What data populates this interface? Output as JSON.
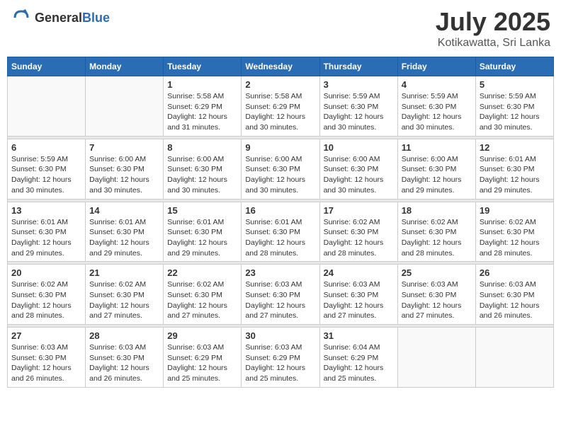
{
  "header": {
    "logo_general": "General",
    "logo_blue": "Blue",
    "month": "July 2025",
    "location": "Kotikawatta, Sri Lanka"
  },
  "days_of_week": [
    "Sunday",
    "Monday",
    "Tuesday",
    "Wednesday",
    "Thursday",
    "Friday",
    "Saturday"
  ],
  "weeks": [
    [
      {
        "day": "",
        "info": ""
      },
      {
        "day": "",
        "info": ""
      },
      {
        "day": "1",
        "info": "Sunrise: 5:58 AM\nSunset: 6:29 PM\nDaylight: 12 hours and 31 minutes."
      },
      {
        "day": "2",
        "info": "Sunrise: 5:58 AM\nSunset: 6:29 PM\nDaylight: 12 hours and 30 minutes."
      },
      {
        "day": "3",
        "info": "Sunrise: 5:59 AM\nSunset: 6:30 PM\nDaylight: 12 hours and 30 minutes."
      },
      {
        "day": "4",
        "info": "Sunrise: 5:59 AM\nSunset: 6:30 PM\nDaylight: 12 hours and 30 minutes."
      },
      {
        "day": "5",
        "info": "Sunrise: 5:59 AM\nSunset: 6:30 PM\nDaylight: 12 hours and 30 minutes."
      }
    ],
    [
      {
        "day": "6",
        "info": "Sunrise: 5:59 AM\nSunset: 6:30 PM\nDaylight: 12 hours and 30 minutes."
      },
      {
        "day": "7",
        "info": "Sunrise: 6:00 AM\nSunset: 6:30 PM\nDaylight: 12 hours and 30 minutes."
      },
      {
        "day": "8",
        "info": "Sunrise: 6:00 AM\nSunset: 6:30 PM\nDaylight: 12 hours and 30 minutes."
      },
      {
        "day": "9",
        "info": "Sunrise: 6:00 AM\nSunset: 6:30 PM\nDaylight: 12 hours and 30 minutes."
      },
      {
        "day": "10",
        "info": "Sunrise: 6:00 AM\nSunset: 6:30 PM\nDaylight: 12 hours and 30 minutes."
      },
      {
        "day": "11",
        "info": "Sunrise: 6:00 AM\nSunset: 6:30 PM\nDaylight: 12 hours and 29 minutes."
      },
      {
        "day": "12",
        "info": "Sunrise: 6:01 AM\nSunset: 6:30 PM\nDaylight: 12 hours and 29 minutes."
      }
    ],
    [
      {
        "day": "13",
        "info": "Sunrise: 6:01 AM\nSunset: 6:30 PM\nDaylight: 12 hours and 29 minutes."
      },
      {
        "day": "14",
        "info": "Sunrise: 6:01 AM\nSunset: 6:30 PM\nDaylight: 12 hours and 29 minutes."
      },
      {
        "day": "15",
        "info": "Sunrise: 6:01 AM\nSunset: 6:30 PM\nDaylight: 12 hours and 29 minutes."
      },
      {
        "day": "16",
        "info": "Sunrise: 6:01 AM\nSunset: 6:30 PM\nDaylight: 12 hours and 28 minutes."
      },
      {
        "day": "17",
        "info": "Sunrise: 6:02 AM\nSunset: 6:30 PM\nDaylight: 12 hours and 28 minutes."
      },
      {
        "day": "18",
        "info": "Sunrise: 6:02 AM\nSunset: 6:30 PM\nDaylight: 12 hours and 28 minutes."
      },
      {
        "day": "19",
        "info": "Sunrise: 6:02 AM\nSunset: 6:30 PM\nDaylight: 12 hours and 28 minutes."
      }
    ],
    [
      {
        "day": "20",
        "info": "Sunrise: 6:02 AM\nSunset: 6:30 PM\nDaylight: 12 hours and 28 minutes."
      },
      {
        "day": "21",
        "info": "Sunrise: 6:02 AM\nSunset: 6:30 PM\nDaylight: 12 hours and 27 minutes."
      },
      {
        "day": "22",
        "info": "Sunrise: 6:02 AM\nSunset: 6:30 PM\nDaylight: 12 hours and 27 minutes."
      },
      {
        "day": "23",
        "info": "Sunrise: 6:03 AM\nSunset: 6:30 PM\nDaylight: 12 hours and 27 minutes."
      },
      {
        "day": "24",
        "info": "Sunrise: 6:03 AM\nSunset: 6:30 PM\nDaylight: 12 hours and 27 minutes."
      },
      {
        "day": "25",
        "info": "Sunrise: 6:03 AM\nSunset: 6:30 PM\nDaylight: 12 hours and 27 minutes."
      },
      {
        "day": "26",
        "info": "Sunrise: 6:03 AM\nSunset: 6:30 PM\nDaylight: 12 hours and 26 minutes."
      }
    ],
    [
      {
        "day": "27",
        "info": "Sunrise: 6:03 AM\nSunset: 6:30 PM\nDaylight: 12 hours and 26 minutes."
      },
      {
        "day": "28",
        "info": "Sunrise: 6:03 AM\nSunset: 6:30 PM\nDaylight: 12 hours and 26 minutes."
      },
      {
        "day": "29",
        "info": "Sunrise: 6:03 AM\nSunset: 6:29 PM\nDaylight: 12 hours and 25 minutes."
      },
      {
        "day": "30",
        "info": "Sunrise: 6:03 AM\nSunset: 6:29 PM\nDaylight: 12 hours and 25 minutes."
      },
      {
        "day": "31",
        "info": "Sunrise: 6:04 AM\nSunset: 6:29 PM\nDaylight: 12 hours and 25 minutes."
      },
      {
        "day": "",
        "info": ""
      },
      {
        "day": "",
        "info": ""
      }
    ]
  ]
}
